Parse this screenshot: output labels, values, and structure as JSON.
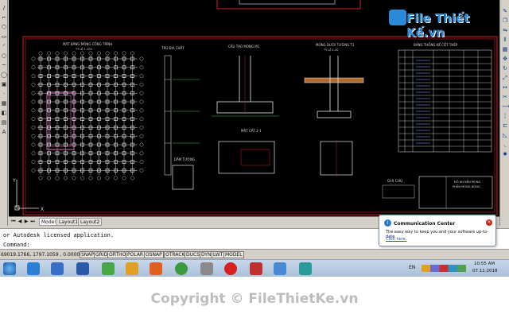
{
  "watermark": {
    "top": "File Thiết Kế.vn",
    "bottom": "Copyright © FileThietKe.vn"
  },
  "drawing": {
    "titles": {
      "plan": "MẶT BẰNG MÓNG CÔNG TRÌNH",
      "plan_scale": "TỶ LỆ 1:100",
      "soil": "TRỤ ĐỊA CHẤT",
      "foundation": "CẤU TẠO MÓNG M1",
      "wall": "MÓNG DƯỚI TƯỜNG T1",
      "wall_scale": "TỶ LỆ 1:20",
      "section": "MẶT CẮT 1-1",
      "beam": "DẦM TƯỜNG",
      "table": "BẢNG THỐNG KÊ CỐT THÉP",
      "notes": "GHI CHÚ",
      "titleblock_1": "ĐỒ ÁN NỀN MÓNG",
      "titleblock_2": "PHẦN MÓNG NÔNG"
    }
  },
  "layout_tabs": [
    "Model",
    "Layout1",
    "Layout2"
  ],
  "command": {
    "history": "or Autodesk licensed application.",
    "prompt": "Command:"
  },
  "status": {
    "coords": "69019.1766, 1797.1059 , 0.0000",
    "toggles": [
      "SNAP",
      "GRID",
      "ORTHO",
      "POLAR",
      "OSNAP",
      "OTRACK",
      "DUCS",
      "DYN",
      "LWT",
      "MODEL"
    ]
  },
  "notification": {
    "title": "Communication Center",
    "body": "The easy way to keep you and your software up-to-date.",
    "link": "Click here."
  },
  "taskbar": {
    "lang": "EN",
    "time": "10:55 AM",
    "date": "07.11.2018"
  },
  "colors": {
    "cad_bg": "#000000",
    "border_red": "#d0202a",
    "grid_line": "#c8c8c8",
    "accent": "#2b8ad8"
  }
}
